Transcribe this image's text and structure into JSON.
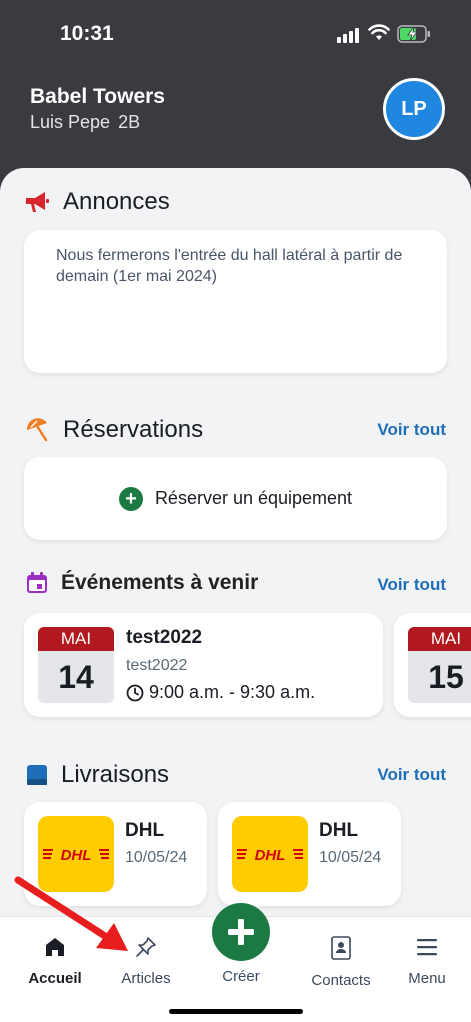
{
  "status": {
    "time": "10:31"
  },
  "header": {
    "title": "Babel Towers",
    "user_name": "Luis Pepe",
    "unit": "2B",
    "avatar_initials": "LP"
  },
  "announcements": {
    "title": "Annonces",
    "text": "Nous fermerons l'entrée du hall latéral à partir de demain (1er mai 2024)"
  },
  "reservations": {
    "title": "Réservations",
    "see_all": "Voir tout",
    "reserve_label": "Réserver un équipement"
  },
  "events": {
    "title": "Événements à venir",
    "see_all": "Voir tout",
    "items": [
      {
        "month": "MAI",
        "day": "14",
        "title": "test2022",
        "subtitle": "test2022",
        "time": "9:00 a.m. - 9:30 a.m."
      },
      {
        "month": "MAI",
        "day": "15"
      }
    ]
  },
  "deliveries": {
    "title": "Livraisons",
    "see_all": "Voir tout",
    "items": [
      {
        "carrier": "DHL",
        "date": "10/05/24",
        "logo_text": "DHL"
      },
      {
        "carrier": "DHL",
        "date": "10/05/24",
        "logo_text": "DHL"
      }
    ]
  },
  "tabbar": {
    "home": "Accueil",
    "articles": "Articles",
    "create": "Créer",
    "contacts": "Contacts",
    "menu": "Menu"
  },
  "colors": {
    "accent_green": "#1b7a43",
    "link_blue": "#1f6fb8",
    "header_bg": "#3a3b40",
    "date_red": "#b2191e",
    "dhl_yellow": "#ffcc00"
  }
}
